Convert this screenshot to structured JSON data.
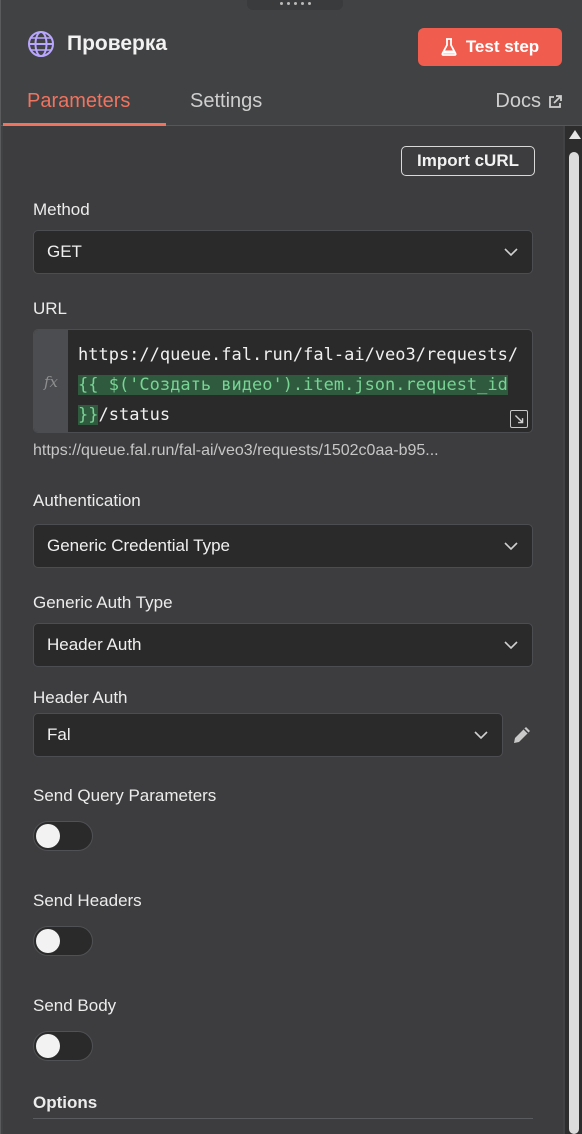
{
  "node": {
    "title": "Проверка",
    "icon": "globe-icon",
    "test_button": "Test step"
  },
  "tabs": [
    {
      "label": "Parameters",
      "active": true
    },
    {
      "label": "Settings",
      "active": false
    }
  ],
  "docs": {
    "label": "Docs",
    "icon": "external-link-icon"
  },
  "import_curl": "Import cURL",
  "method": {
    "label": "Method",
    "value": "GET"
  },
  "url": {
    "label": "URL",
    "prefix": "https://queue.fal.run/fal-ai/veo3/requests/",
    "expression": "{{ $('Создать видео').item.json.request_id }}",
    "suffix": "/status",
    "resolved_preview": "https://queue.fal.run/fal-ai/veo3/requests/1502c0aa-b95..."
  },
  "authentication": {
    "label": "Authentication",
    "value": "Generic Credential Type"
  },
  "generic_auth_type": {
    "label": "Generic Auth Type",
    "value": "Header Auth"
  },
  "header_auth": {
    "label": "Header Auth",
    "value": "Fal"
  },
  "send_query_parameters": {
    "label": "Send Query Parameters",
    "enabled": false
  },
  "send_headers": {
    "label": "Send Headers",
    "enabled": false
  },
  "send_body": {
    "label": "Send Body",
    "enabled": false
  },
  "options": {
    "label": "Options"
  },
  "colors": {
    "accent": "#f0735f",
    "test_button": "#f05d4e",
    "expression_text": "#79d395",
    "expression_bg": "#2f5a3e"
  }
}
